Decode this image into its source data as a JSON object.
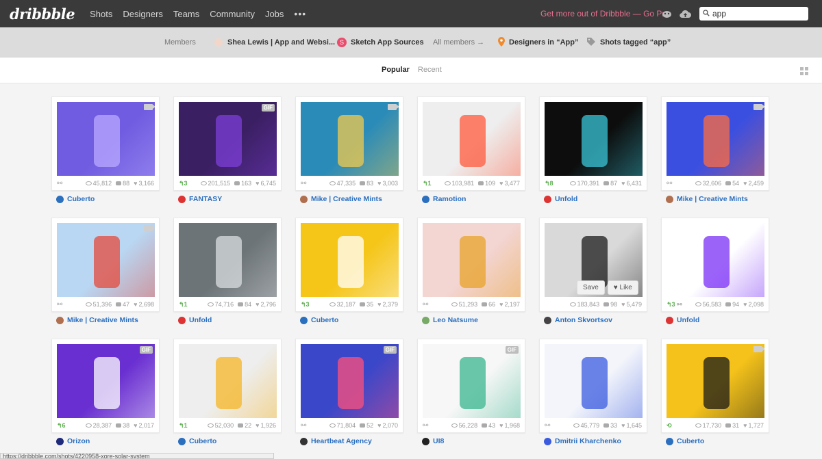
{
  "nav": {
    "logo": "dribbble",
    "links": [
      "Shots",
      "Designers",
      "Teams",
      "Community",
      "Jobs"
    ],
    "more": "•••",
    "promo": "Get more out of Dribbble — Go Pro",
    "search_value": "app"
  },
  "members": {
    "label": "Members",
    "items": [
      "Shea Lewis | App and Websi...",
      "Sketch App Sources"
    ],
    "all_link": "All members →",
    "designers_in": "Designers in “App”",
    "shots_tagged": "Shots tagged “app”"
  },
  "tabs": {
    "popular": "Popular",
    "recent": "Recent"
  },
  "shots": [
    {
      "views": "45,812",
      "comments": "88",
      "likes": "3,166",
      "rebound": "",
      "link": true,
      "author": "Cuberto",
      "badge": "video",
      "bg": "#6f5ce0",
      "accent": "#b9a9ff",
      "av": "#2b6fbf"
    },
    {
      "views": "201,515",
      "comments": "163",
      "likes": "6,745",
      "rebound": "3",
      "link": false,
      "author": "FANTASY",
      "badge": "GIF",
      "bg": "#3b1f63",
      "accent": "#7d3fd8",
      "av": "#d33"
    },
    {
      "views": "47,335",
      "comments": "83",
      "likes": "3,003",
      "rebound": "",
      "link": true,
      "author": "Mike | Creative Mints",
      "badge": "video",
      "bg": "#2a8bb8",
      "accent": "#f2c94c",
      "av": "#b07050"
    },
    {
      "views": "103,981",
      "comments": "109",
      "likes": "3,477",
      "rebound": "1",
      "link": false,
      "author": "Ramotion",
      "badge": "",
      "bg": "#eeeeee",
      "accent": "#ff5a3c",
      "av": "#2b6fbf"
    },
    {
      "views": "170,391",
      "comments": "87",
      "likes": "6,431",
      "rebound": "8",
      "link": false,
      "author": "Unfold",
      "badge": "",
      "bg": "#0d0d0d",
      "accent": "#39c6d8",
      "av": "#d33"
    },
    {
      "views": "32,606",
      "comments": "54",
      "likes": "2,459",
      "rebound": "",
      "link": true,
      "author": "Mike | Creative Mints",
      "badge": "video",
      "bg": "#3a4fe0",
      "accent": "#ff6b3d",
      "av": "#b07050"
    },
    {
      "views": "51,396",
      "comments": "47",
      "likes": "2,698",
      "rebound": "",
      "link": true,
      "author": "Mike | Creative Mints",
      "badge": "video",
      "bg": "#b9d6f2",
      "accent": "#e64a3b",
      "av": "#b07050"
    },
    {
      "views": "74,716",
      "comments": "84",
      "likes": "2,796",
      "rebound": "1",
      "link": false,
      "author": "Unfold",
      "badge": "",
      "bg": "#6d7478",
      "accent": "#d9dde0",
      "av": "#d33"
    },
    {
      "views": "32,187",
      "comments": "35",
      "likes": "2,379",
      "rebound": "3",
      "link": false,
      "author": "Cuberto",
      "badge": "",
      "bg": "#f5c518",
      "accent": "#ffffff",
      "av": "#2b6fbf"
    },
    {
      "views": "51,293",
      "comments": "66",
      "likes": "2,197",
      "rebound": "",
      "link": true,
      "author": "Leo Natsume",
      "badge": "",
      "bg": "#f3d5d2",
      "accent": "#e8a32a",
      "av": "#7a6"
    },
    {
      "views": "183,843",
      "comments": "98",
      "likes": "5,479",
      "rebound": "",
      "link": false,
      "author": "Anton Skvortsov",
      "badge": "",
      "bg": "#d9d9d9",
      "accent": "#1b1b1b",
      "av": "#444",
      "hover": true
    },
    {
      "views": "56,583",
      "comments": "94",
      "likes": "2,098",
      "rebound": "3",
      "link": true,
      "author": "Unfold",
      "badge": "",
      "bg": "#ffffff",
      "accent": "#7b2ff7",
      "av": "#d33"
    },
    {
      "views": "28,387",
      "comments": "38",
      "likes": "2,017",
      "rebound": "6",
      "link": false,
      "author": "Orizon",
      "badge": "GIF",
      "bg": "#6a2fd1",
      "accent": "#ffffff",
      "av": "#1e2a7a"
    },
    {
      "views": "52,030",
      "comments": "22",
      "likes": "1,926",
      "rebound": "1",
      "link": false,
      "author": "Cuberto",
      "badge": "",
      "bg": "#eeeeee",
      "accent": "#f5b626",
      "av": "#2b6fbf"
    },
    {
      "views": "71,804",
      "comments": "52",
      "likes": "2,070",
      "rebound": "",
      "link": true,
      "author": "Heartbeat Agency",
      "badge": "GIF",
      "bg": "#3b47c9",
      "accent": "#ff4f7a",
      "av": "#333"
    },
    {
      "views": "56,228",
      "comments": "43",
      "likes": "1,968",
      "rebound": "",
      "link": true,
      "author": "UI8",
      "badge": "GIF",
      "bg": "#f7f7f7",
      "accent": "#39b58f",
      "av": "#222"
    },
    {
      "views": "45,779",
      "comments": "33",
      "likes": "1,645",
      "rebound": "",
      "link": true,
      "author": "Dmitrii Kharchenko",
      "badge": "",
      "bg": "#f3f5fb",
      "accent": "#3a5be0",
      "av": "#3a5be0"
    },
    {
      "views": "17,730",
      "comments": "31",
      "likes": "1,727",
      "rebound": "",
      "link": false,
      "author": "Cuberto",
      "badge": "video",
      "bg": "#f4c21a",
      "accent": "#1a1a1a",
      "av": "#2b6fbf",
      "rebound_icon": true
    }
  ],
  "hover_actions": {
    "save": "Save",
    "like": "Like"
  },
  "statusbar": "https://dribbble.com/shots/4220958-xore-solar-system"
}
